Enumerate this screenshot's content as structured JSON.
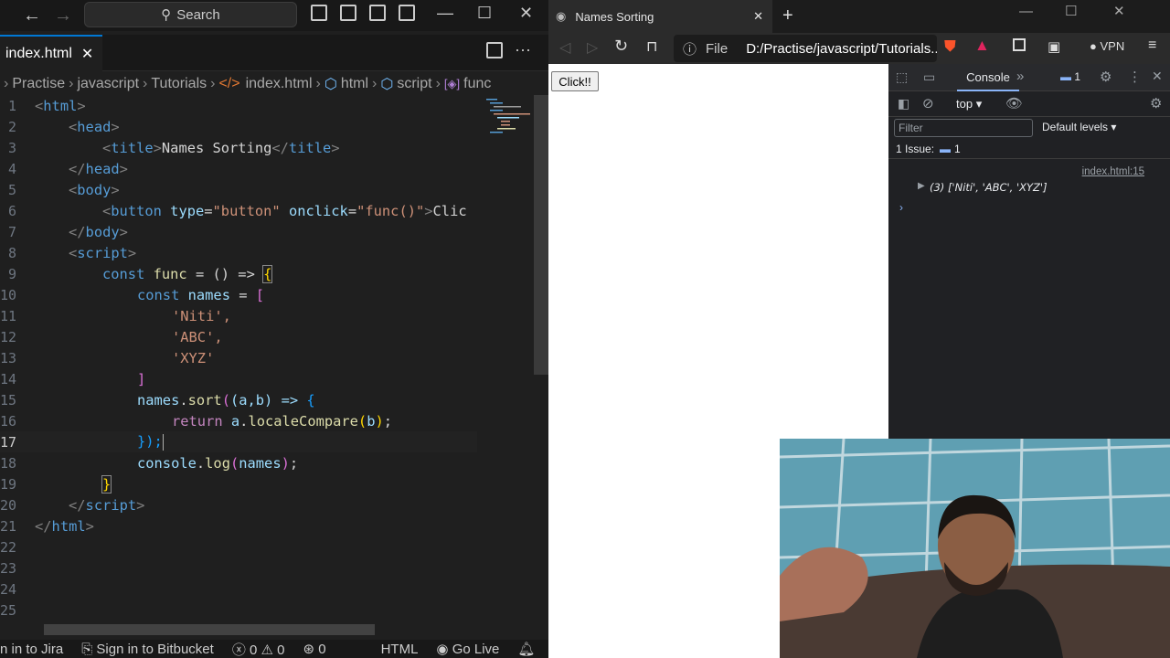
{
  "vscode": {
    "search_label": "Search",
    "tab_filename": "index.html",
    "breadcrumb": [
      "Practise",
      "javascript",
      "Tutorials",
      "index.html",
      "html",
      "script",
      "func"
    ],
    "line_numbers": [
      "1",
      "2",
      "3",
      "4",
      "5",
      "6",
      "7",
      "8",
      "9",
      "10",
      "11",
      "12",
      "13",
      "14",
      "15",
      "16",
      "17",
      "18",
      "19",
      "20",
      "21",
      "22",
      "23",
      "24",
      "25"
    ],
    "code": {
      "l1_tag": "html",
      "l2_tag": "head",
      "l3_tag": "title",
      "l3_text": "Names Sorting",
      "l3_close": "title",
      "l4_tag": "head",
      "l5_tag": "body",
      "l6_tag": "button",
      "l6_attr1": "type",
      "l6_val1": "\"button\"",
      "l6_attr2": "onclick",
      "l6_val2": "\"func()\"",
      "l6_rest": "Clic",
      "l7_tag": "body",
      "l8_tag": "script",
      "l9_kw": "const",
      "l9_fn": "func",
      "l9_op": " = () => ",
      "l10_kw": "const",
      "l10_var": "names",
      "l10_op": " = ",
      "l11": "'Niti',",
      "l12": "'ABC',",
      "l13": "'XYZ'",
      "l15_var": "names",
      "l15_fn": "sort",
      "l15_args": "(a,b) => ",
      "l16_kw": "return",
      "l16_var": "a",
      "l16_fn": "localeCompare",
      "l16_arg": "b",
      "l17": "});",
      "l18_var": "console",
      "l18_fn": "log",
      "l18_arg": "names",
      "l20_tag": "script",
      "l21_tag": "html"
    },
    "status": {
      "jira": "n in to Jira",
      "bitbucket": "Sign in to Bitbucket",
      "errors": "0",
      "warnings": "0",
      "ports": "0",
      "language": "HTML",
      "golive": "Go Live"
    }
  },
  "browser": {
    "tab_title": "Names Sorting",
    "url_scheme": "File",
    "url": "D:/Practise/javascript/Tutorials...",
    "vpn": "VPN",
    "page_button": "Click!!"
  },
  "devtools": {
    "console_tab": "Console",
    "issue_badge": "1",
    "context": "top",
    "filter_placeholder": "Filter",
    "levels": "Default levels",
    "issues_text": "1 Issue:",
    "issues_count": "1",
    "log_source": "index.html:15",
    "log_value": "(3) ['Niti', 'ABC', 'XYZ']"
  }
}
